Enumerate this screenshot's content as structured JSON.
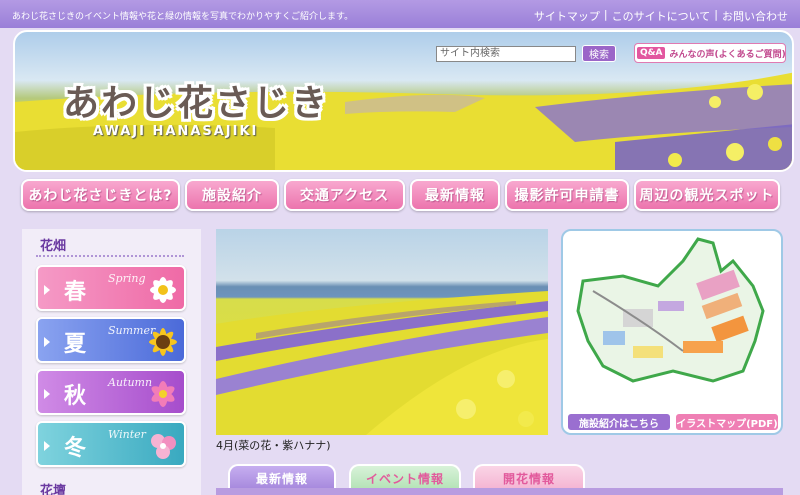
{
  "header": {
    "tagline": "あわじ花さじきのイベント情報や花と緑の情報を写真でわかりやすくご紹介します。",
    "top_links": [
      "サイトマップ",
      "このサイトについて",
      "お問い合わせ"
    ],
    "logo_jp": "あわじ花さじき",
    "logo_en": "AWAJI HANASAJIKI",
    "search_placeholder": "サイト内検索",
    "search_button": "検索",
    "qa_badge": "Q&A",
    "qa_label": "みんなの声(よくあるご質問)"
  },
  "nav": {
    "items": [
      "あわじ花さじきとは?",
      "施設紹介",
      "交通アクセス",
      "最新情報",
      "撮影許可申請書",
      "周辺の観光スポット"
    ]
  },
  "sidebar": {
    "heading1": "花畑",
    "seasons": [
      {
        "kanji": "春",
        "en": "Spring"
      },
      {
        "kanji": "夏",
        "en": "Summer"
      },
      {
        "kanji": "秋",
        "en": "Autumn"
      },
      {
        "kanji": "冬",
        "en": "Winter"
      }
    ],
    "heading2": "花壇"
  },
  "main": {
    "caption": "4月(菜の花・紫ハナナ)"
  },
  "map": {
    "facility_button": "施設紹介はこちら",
    "illust_button": "イラストマップ(PDF)"
  },
  "tabs": [
    "最新情報",
    "イベント情報",
    "開花情報"
  ],
  "colors": {
    "accent_purple": "#9a7fd8",
    "nav_pink": "#ec74ad",
    "spring": "#f06aa8",
    "summer": "#5b7be0",
    "autumn": "#b45ad2",
    "winter": "#47b7c9"
  }
}
